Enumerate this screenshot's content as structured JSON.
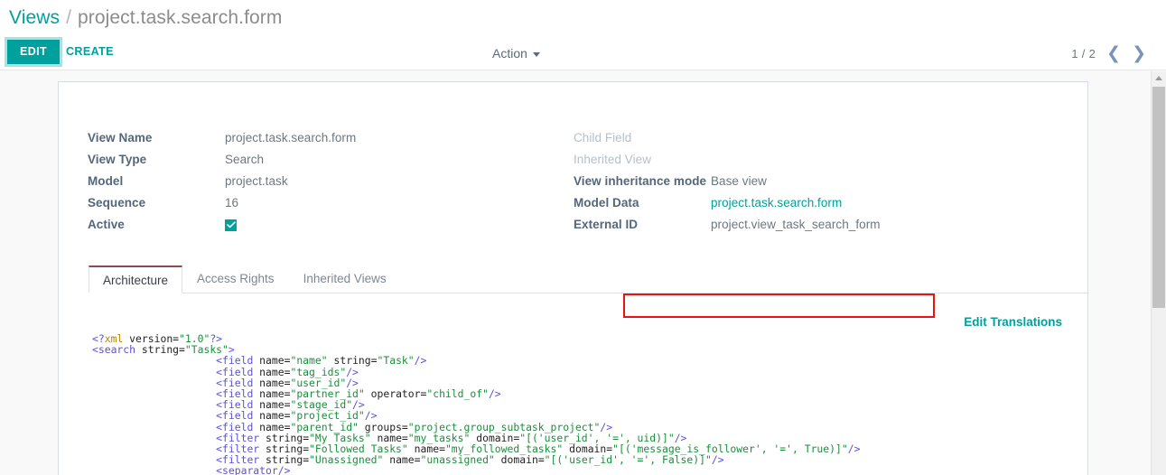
{
  "breadcrumb": {
    "root": "Views",
    "separator": "/",
    "current": "project.task.search.form"
  },
  "control_panel": {
    "edit_label": "EDIT",
    "create_label": "CREATE",
    "action_label": "Action",
    "caret_icon": "chevron-down-icon",
    "pager_count": "1 / 2",
    "prev_icon": "❮",
    "next_icon": "❯"
  },
  "form": {
    "left_fields": [
      {
        "label": "View Name",
        "value": "project.task.search.form",
        "muted": false,
        "type": "text"
      },
      {
        "label": "View Type",
        "value": "Search",
        "muted": false,
        "type": "text"
      },
      {
        "label": "Model",
        "value": "project.task",
        "muted": false,
        "type": "text"
      },
      {
        "label": "Sequence",
        "value": "16",
        "muted": false,
        "type": "text"
      },
      {
        "label": "Active",
        "value": "",
        "muted": false,
        "type": "checkbox",
        "checked": true
      }
    ],
    "right_fields": [
      {
        "label": "Child Field",
        "value": "",
        "muted": true,
        "type": "text"
      },
      {
        "label": "Inherited View",
        "value": "",
        "muted": true,
        "type": "text"
      },
      {
        "label": "View inheritance mode",
        "value": "Base view",
        "muted": false,
        "type": "text"
      },
      {
        "label": "Model Data",
        "value": "project.task.search.form",
        "muted": false,
        "type": "link"
      },
      {
        "label": "External ID",
        "value": "project.view_task_search_form",
        "muted": false,
        "type": "text"
      }
    ],
    "highlight_color": "#ee1111"
  },
  "notebook": {
    "tabs": [
      {
        "label": "Architecture",
        "active": true
      },
      {
        "label": "Access Rights",
        "active": false
      },
      {
        "label": "Inherited Views",
        "active": false
      }
    ]
  },
  "architecture": {
    "edit_translations_label": "Edit Translations",
    "xml_lines": [
      "<?xml version=\"1.0\"?>",
      "<search string=\"Tasks\">",
      "                    <field name=\"name\" string=\"Task\"/>",
      "                    <field name=\"tag_ids\"/>",
      "                    <field name=\"user_id\"/>",
      "                    <field name=\"partner_id\" operator=\"child_of\"/>",
      "                    <field name=\"stage_id\"/>",
      "                    <field name=\"project_id\"/>",
      "                    <field name=\"parent_id\" groups=\"project.group_subtask_project\"/>",
      "                    <filter string=\"My Tasks\" name=\"my_tasks\" domain=\"[('user_id', '=', uid)]\"/>",
      "                    <filter string=\"Followed Tasks\" name=\"my_followed_tasks\" domain=\"[('message_is_follower', '=', True)]\"/>",
      "                    <filter string=\"Unassigned\" name=\"unassigned\" domain=\"[('user_id', '=', False)]\"/>",
      "                    <separator/>"
    ]
  },
  "scrollbar": {
    "up_arrow_icon": "triangle-up-icon"
  },
  "colors": {
    "accent": "#00a09d",
    "link": "#00a09d",
    "label": "#54667a",
    "muted": "#b6bfc9",
    "highlight": "#ee1111"
  }
}
